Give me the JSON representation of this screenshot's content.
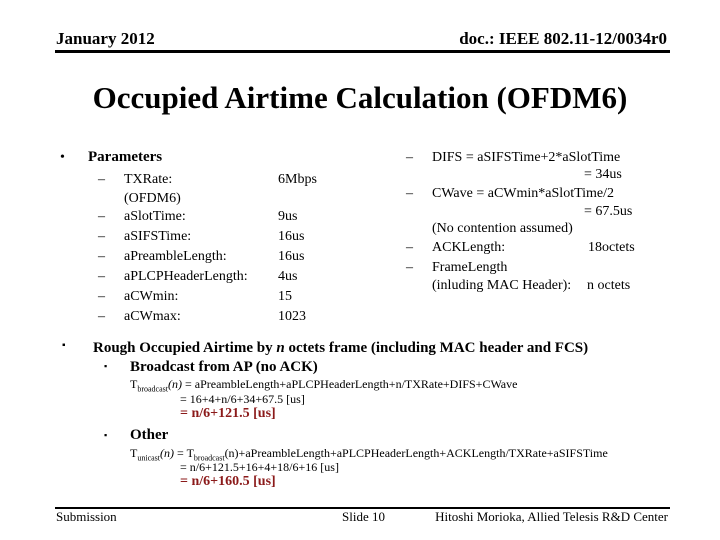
{
  "header": {
    "date": "January 2012",
    "doc_id": "doc.: IEEE 802.11-12/0034r0"
  },
  "title": "Occupied Airtime Calculation (OFDM6)",
  "parameters": {
    "heading": "Parameters",
    "items": [
      {
        "name": "TXRate:",
        "name2": "(OFDM6)",
        "value": "6Mbps"
      },
      {
        "name": "aSlotTime:",
        "value": "9us"
      },
      {
        "name": "aSIFSTime:",
        "value": "16us"
      },
      {
        "name": "aPreambleLength:",
        "value": "16us"
      },
      {
        "name": "aPLCPHeaderLength:",
        "value": "4us"
      },
      {
        "name": "aCWmin:",
        "value": "15"
      },
      {
        "name": "aCWmax:",
        "value": "1023"
      }
    ]
  },
  "derived": {
    "difs": {
      "expr": "DIFS = aSIFSTime+2*aSlotTime",
      "result": "= 34us"
    },
    "cwave": {
      "expr": "CWave = aCWmin*aSlotTime/2",
      "result": "= 67.5us",
      "note": "(No contention assumed)"
    },
    "ack": {
      "name": "ACKLength:",
      "value": "18octets"
    },
    "frame": {
      "name": "FrameLength",
      "name2": "(inluding MAC Header):",
      "value": "n octets"
    }
  },
  "rough": {
    "heading_pre": "Rough Occupied Airtime by ",
    "heading_n": "n",
    "heading_post": " octets frame (including MAC header and FCS)",
    "broadcast": {
      "heading": "Broadcast from AP (no ACK)",
      "lhs_T": "T",
      "lhs_sub": "broadcast",
      "lhs_arg": "(n)",
      "rhs": " = aPreambleLength+aPLCPHeaderLength+n/TXRate+DIFS+CWave",
      "line2": "= 16+4+n/6+34+67.5 [us]",
      "result": "= n/6+121.5 [us]"
    },
    "other": {
      "heading": "Other",
      "lhs_T": "T",
      "lhs_sub": "unicast",
      "lhs_arg": "(n)",
      "rhs_T": " = T",
      "rhs_sub": "broadcast",
      "rhs": "(n)+aPreambleLength+aPLCPHeaderLength+ACKLength/TXRate+aSIFSTime",
      "line2": "= n/6+121.5+16+4+18/6+16 [us]",
      "result": "= n/6+160.5 [us]"
    }
  },
  "footer": {
    "left": "Submission",
    "center": "Slide 10",
    "right": "Hitoshi Morioka, Allied Telesis R&D Center"
  },
  "colors": {
    "result": "#8b1a1a"
  }
}
